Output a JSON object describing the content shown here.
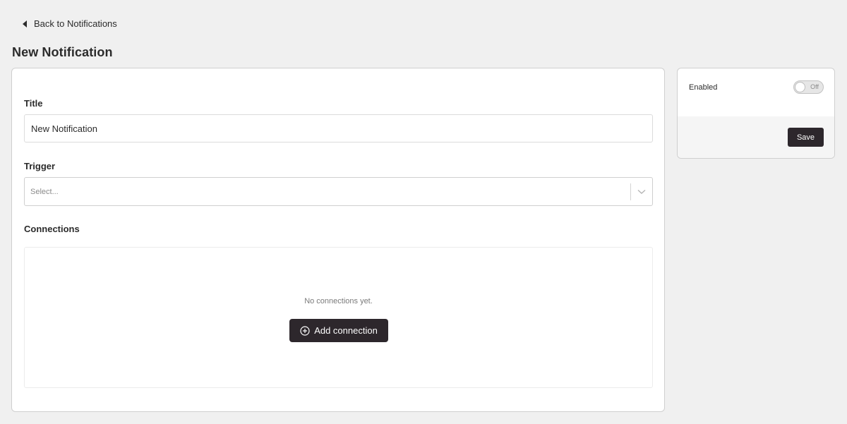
{
  "nav": {
    "back_label": "Back to Notifications",
    "back_icon": "caret-left-icon"
  },
  "page": {
    "title": "New Notification"
  },
  "form": {
    "title_label": "Title",
    "title_value": "New Notification",
    "trigger_label": "Trigger",
    "trigger_placeholder": "Select...",
    "connections_label": "Connections",
    "connections_empty": "No connections yet.",
    "add_connection_label": "Add connection",
    "add_connection_icon": "plus-circle-icon"
  },
  "sidebar": {
    "enabled_label": "Enabled",
    "toggle_state": "Off",
    "save_label": "Save"
  },
  "colors": {
    "background": "#f0f0f0",
    "card": "#ffffff",
    "primary_button": "#2d272c",
    "text": "#2b2b2b"
  }
}
